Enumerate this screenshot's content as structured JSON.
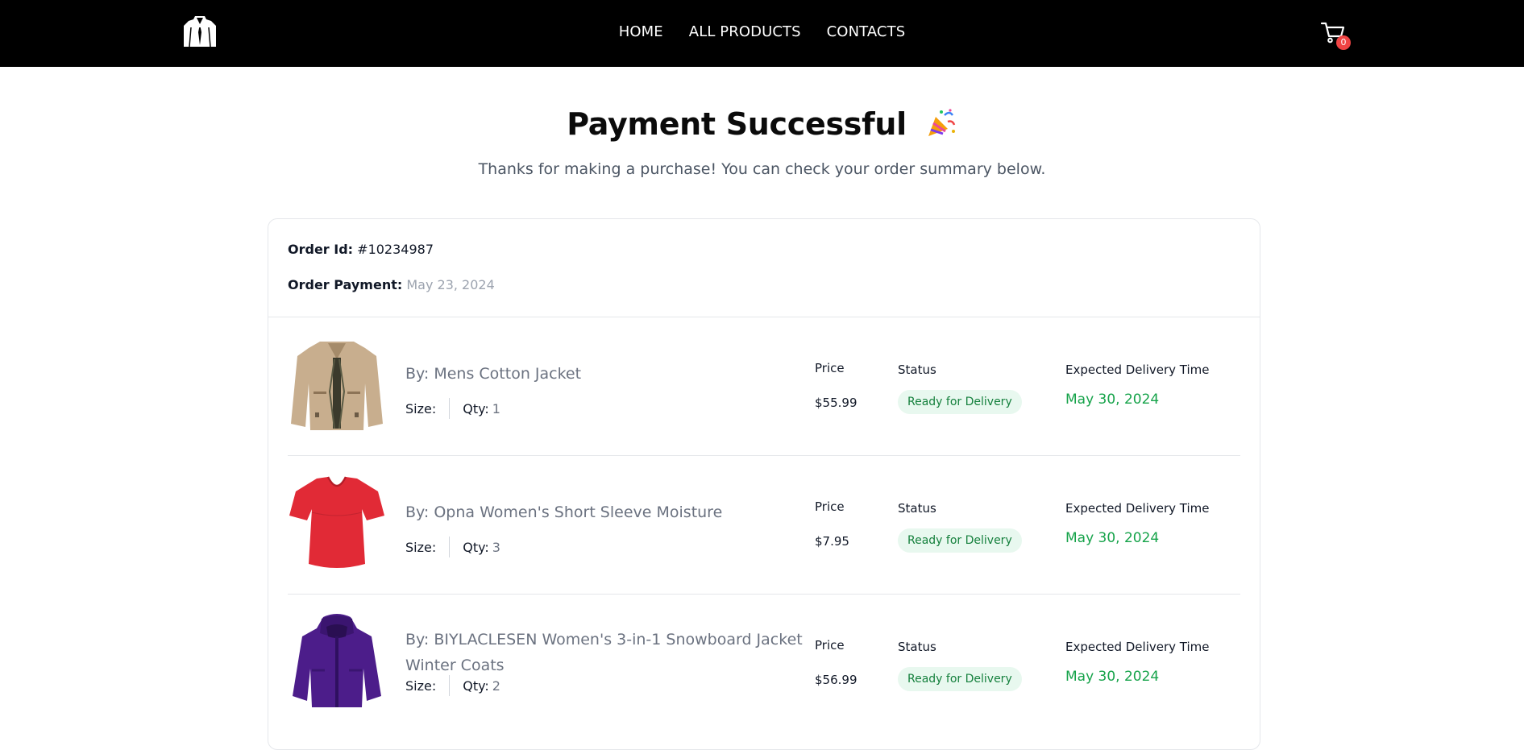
{
  "header": {
    "logo_icon": "suit-jacket-icon",
    "nav": [
      "HOME",
      "ALL PRODUCTS",
      "CONTACTS"
    ],
    "cart_icon": "shopping-cart-icon",
    "cart_count": "0",
    "cart_badge_color": "#ef4444"
  },
  "hero": {
    "title": "Payment Successful",
    "title_icon": "party-popper-icon",
    "subtitle": "Thanks for making a purchase! You can check your order summary below."
  },
  "order": {
    "id_label": "Order Id:",
    "id_value": "#10234987",
    "payment_label": "Order Payment:",
    "payment_value": "May 23, 2024"
  },
  "columns": {
    "price": "Price",
    "status": "Status",
    "delivery": "Expected Delivery Time"
  },
  "labels": {
    "size": "Size:",
    "qty": "Qty:"
  },
  "items": [
    {
      "name": "By: Mens Cotton Jacket",
      "image_icon": "khaki-jacket-image",
      "qty": "1",
      "price": "$55.99",
      "status": "Ready for Delivery",
      "delivery": "May 30, 2024"
    },
    {
      "name": "By: Opna Women's Short Sleeve Moisture",
      "image_icon": "red-tshirt-image",
      "qty": "3",
      "price": "$7.95",
      "status": "Ready for Delivery",
      "delivery": "May 30, 2024"
    },
    {
      "name": "By: BIYLACLESEN Women's 3-in-1 Snowboard Jacket Winter Coats",
      "image_icon": "purple-jacket-image",
      "qty": "2",
      "price": "$56.99",
      "status": "Ready for Delivery",
      "delivery": "May 30, 2024"
    }
  ],
  "colors": {
    "header_bg": "#000000",
    "status_text": "#15803d",
    "status_bg": "#e8f8ef",
    "delivery_text": "#16a34a"
  }
}
